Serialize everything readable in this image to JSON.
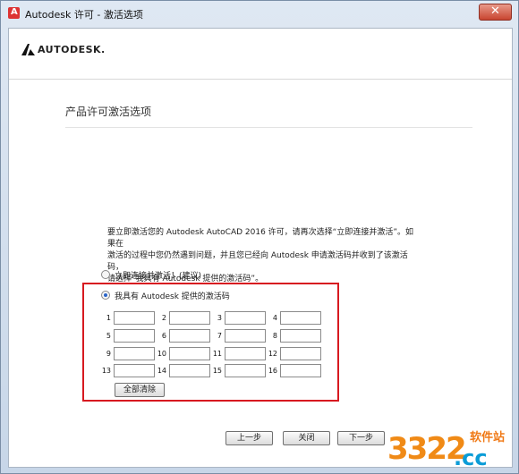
{
  "window": {
    "title": "Autodesk 许可 - 激活选项",
    "close_symbol": "✕"
  },
  "brand": {
    "logo_text": "AUTODESK.",
    "logo_color": "#111111"
  },
  "page": {
    "title": "产品许可激活选项",
    "description": [
      "要立即激活您的 Autodesk AutoCAD 2016 许可，请再次选择“立即连接并激活”。如果在",
      "激活的过程中您仍然遇到问题，并且您已经向 Autodesk 申请激活码并收到了该激活码，",
      "请选择“我具有 Autodesk 提供的激活码”。"
    ]
  },
  "options": {
    "connect_now": "立即连接并激活！(建议)",
    "have_code": "我具有 Autodesk 提供的激活码"
  },
  "activation_code": {
    "labels": [
      "1",
      "2",
      "3",
      "4",
      "5",
      "6",
      "7",
      "8",
      "9",
      "10",
      "11",
      "12",
      "13",
      "14",
      "15",
      "16"
    ],
    "clear_all": "全部清除"
  },
  "buttons": {
    "back": "上一步",
    "close": "关闭",
    "next": "下一步"
  },
  "watermark": {
    "number": "3322",
    "suffix": ".cc",
    "site": "软件站"
  },
  "colors": {
    "highlight_border": "#d71920",
    "watermark_orange": "#f08a16",
    "watermark_blue": "#0b9cd7"
  }
}
